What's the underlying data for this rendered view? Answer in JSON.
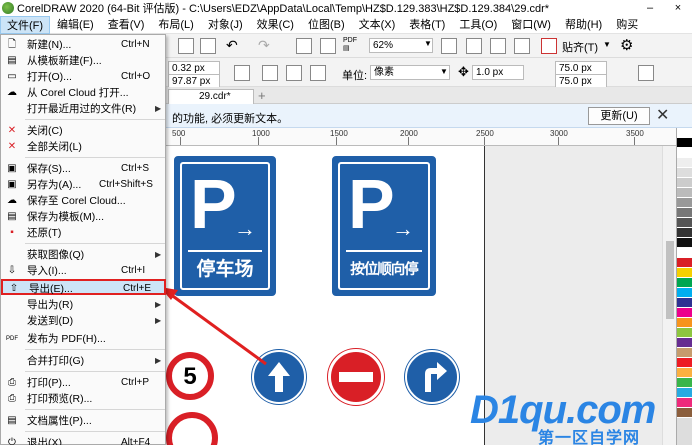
{
  "window": {
    "title": "CorelDRAW 2020 (64-Bit 评估版) - C:\\Users\\EDZ\\AppData\\Local\\Temp\\HZ$D.129.383\\HZ$D.129.384\\29.cdr*",
    "minimize": "–",
    "close": "×"
  },
  "menubar": [
    {
      "label": "文件(F)"
    },
    {
      "label": "编辑(E)"
    },
    {
      "label": "查看(V)"
    },
    {
      "label": "布局(L)"
    },
    {
      "label": "对象(J)"
    },
    {
      "label": "效果(C)"
    },
    {
      "label": "位图(B)"
    },
    {
      "label": "文本(X)"
    },
    {
      "label": "表格(T)"
    },
    {
      "label": "工具(O)"
    },
    {
      "label": "窗口(W)"
    },
    {
      "label": "帮助(H)"
    },
    {
      "label": "购买"
    }
  ],
  "toolbar": {
    "zoom": "62%",
    "paste_label": "贴齐(T)",
    "width_value": "0.32 px",
    "height_value": "97.87 px",
    "unit_label": "单位:",
    "unit_value": "像素",
    "nudge_value": "1.0 px",
    "dup_x": "75.0 px",
    "dup_y": "75.0 px"
  },
  "tab": {
    "label": "29.cdr*",
    "plus": "+"
  },
  "notice": {
    "text": "的功能, 必须更新文本。",
    "button": "更新(U)",
    "close": "✕"
  },
  "ruler": {
    "labels": [
      "500",
      "1000",
      "1500",
      "2000",
      "2500",
      "3000",
      "3500"
    ]
  },
  "signs": {
    "parking1": {
      "letter": "P",
      "arrow": "→",
      "label": "停车场"
    },
    "parking2": {
      "letter": "P",
      "arrow": "→",
      "label": "按位顺向停放"
    },
    "speed_limit": "5"
  },
  "file_menu": {
    "items": [
      {
        "label": "新建(N)...",
        "shortcut": "Ctrl+N",
        "icon": "new-doc-icon"
      },
      {
        "label": "从模板新建(F)...",
        "shortcut": "",
        "icon": "template-icon"
      },
      {
        "label": "打开(O)...",
        "shortcut": "Ctrl+O",
        "icon": "folder-icon"
      },
      {
        "label": "从 Corel Cloud 打开...",
        "shortcut": "",
        "icon": "cloud-icon"
      },
      {
        "label": "打开最近用过的文件(R)",
        "shortcut": "",
        "icon": ""
      },
      {
        "label": "关闭(C)",
        "shortcut": "",
        "icon": "close-doc-icon"
      },
      {
        "label": "全部关闭(L)",
        "shortcut": "",
        "icon": "close-all-icon"
      },
      {
        "label": "保存(S)...",
        "shortcut": "Ctrl+S",
        "icon": "save-icon"
      },
      {
        "label": "另存为(A)...",
        "shortcut": "Ctrl+Shift+S",
        "icon": "save-as-icon"
      },
      {
        "label": "保存至 Corel Cloud...",
        "shortcut": "",
        "icon": "cloud-save-icon"
      },
      {
        "label": "保存为模板(M)...",
        "shortcut": "",
        "icon": "save-template-icon"
      },
      {
        "label": "还原(T)",
        "shortcut": "",
        "icon": "revert-icon"
      },
      {
        "label": "获取图像(Q)",
        "shortcut": "",
        "icon": ""
      },
      {
        "label": "导入(I)...",
        "shortcut": "Ctrl+I",
        "icon": "import-icon"
      },
      {
        "label": "导出(E)...",
        "shortcut": "Ctrl+E",
        "icon": "export-icon"
      },
      {
        "label": "导出为(R)",
        "shortcut": "",
        "icon": ""
      },
      {
        "label": "发送到(D)",
        "shortcut": "",
        "icon": ""
      },
      {
        "label": "发布为 PDF(H)...",
        "shortcut": "",
        "icon": "pdf-icon"
      },
      {
        "label": "合并打印(G)",
        "shortcut": "",
        "icon": ""
      },
      {
        "label": "打印(P)...",
        "shortcut": "Ctrl+P",
        "icon": "print-icon"
      },
      {
        "label": "打印预览(R)...",
        "shortcut": "",
        "icon": "print-preview-icon"
      },
      {
        "label": "文档属性(P)...",
        "shortcut": "",
        "icon": "doc-props-icon"
      },
      {
        "label": "退出(X)",
        "shortcut": "Alt+F4",
        "icon": "exit-icon"
      }
    ]
  },
  "watermark": {
    "big": "D1qu.com",
    "sub": "第一区自学网"
  },
  "colors": {
    "sign_blue": "#1f5fa8",
    "highlight_border": "#e02020",
    "watermark_blue": "#2b85e4"
  }
}
